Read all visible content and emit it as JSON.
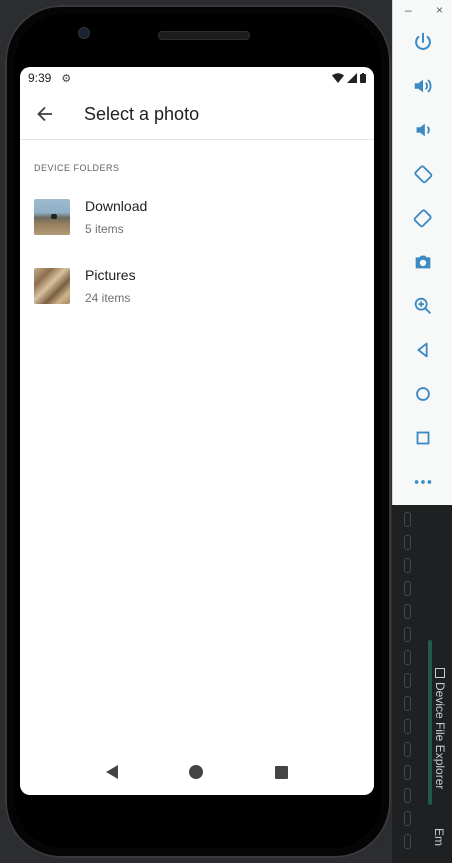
{
  "emulator": {
    "minimize": "–",
    "close": "×",
    "buttons": [
      "power-icon",
      "volume-up-icon",
      "volume-down-icon",
      "rotate-left-icon",
      "rotate-right-icon",
      "camera-icon",
      "zoom-icon",
      "back-icon",
      "home-icon",
      "overview-icon",
      "more-icon"
    ]
  },
  "status_bar": {
    "time": "9:39"
  },
  "app_bar": {
    "title": "Select a photo"
  },
  "section": {
    "label": "DEVICE FOLDERS"
  },
  "folders": [
    {
      "name": "Download",
      "count": "5 items"
    },
    {
      "name": "Pictures",
      "count": "24 items"
    }
  ],
  "ide": {
    "side_tab": "Device File Explorer",
    "side_tab2": "Em"
  }
}
